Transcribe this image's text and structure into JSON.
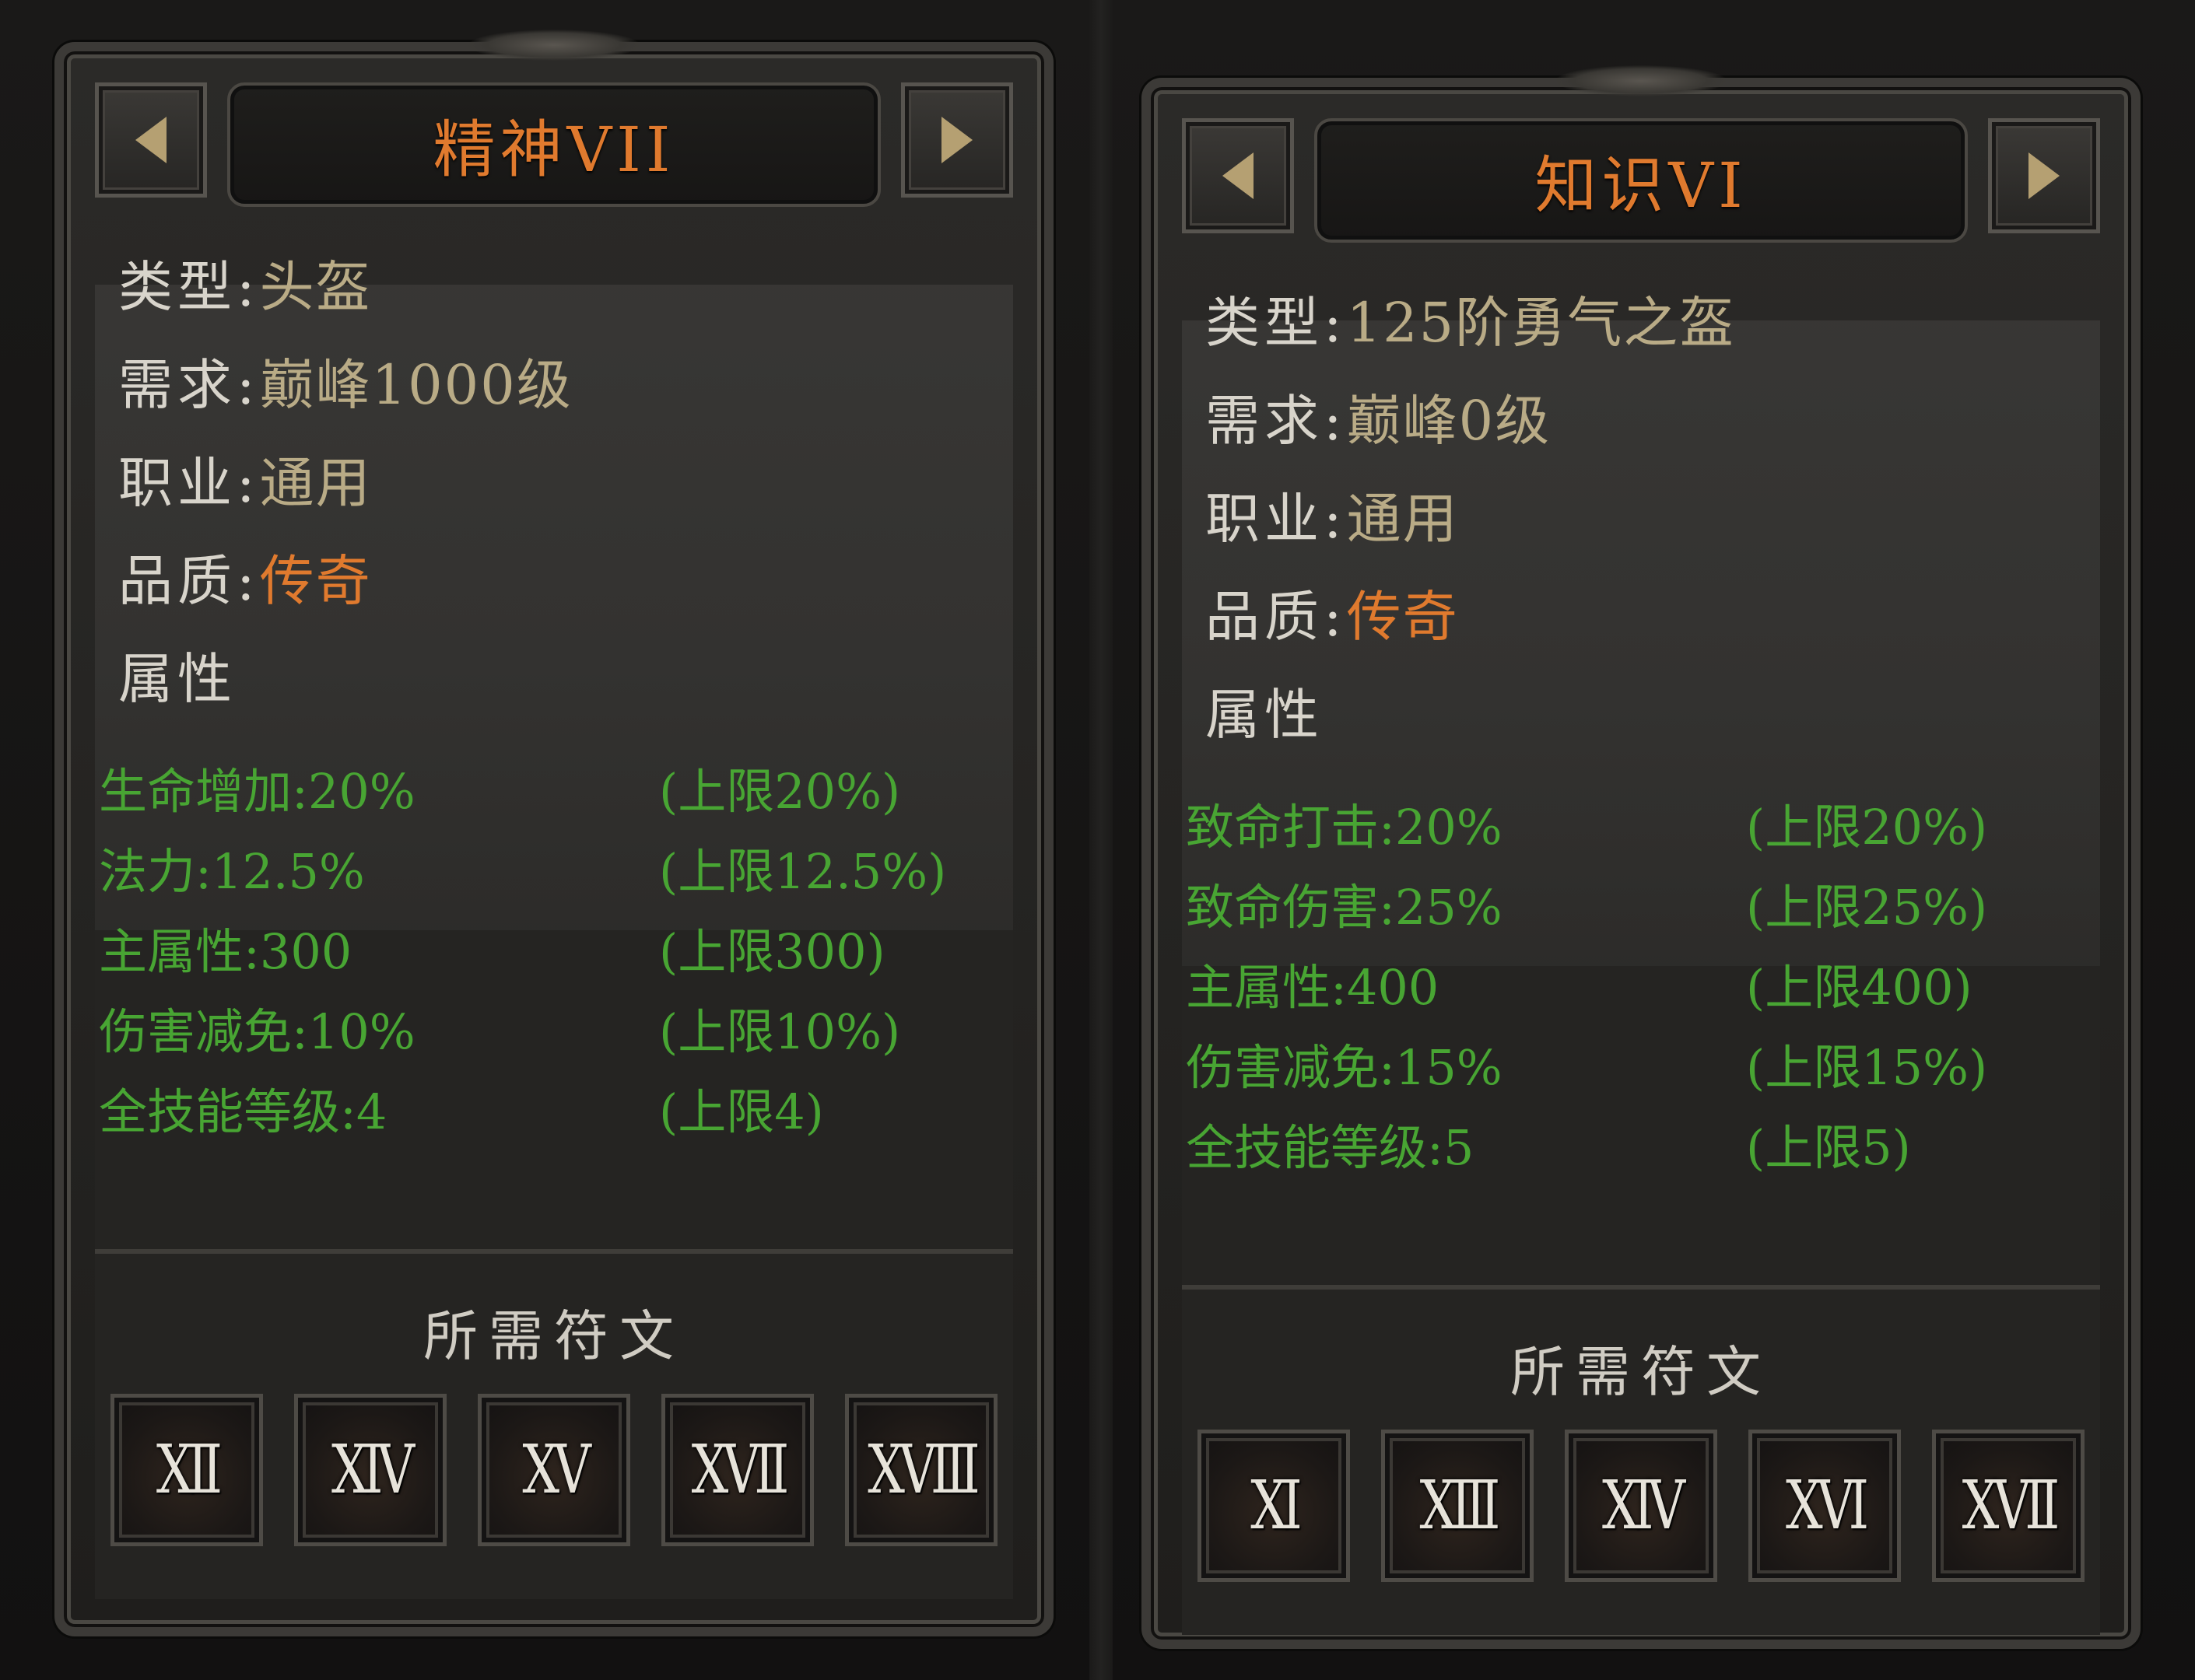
{
  "panels": [
    {
      "title": "精神VII",
      "info": [
        {
          "label": "类型:",
          "value": "头盔"
        },
        {
          "label": "需求:",
          "value": "巅峰1000级"
        },
        {
          "label": "职业:",
          "value": "通用"
        },
        {
          "label": "品质:",
          "value": "传奇"
        }
      ],
      "attr_heading": "属性",
      "attributes": [
        {
          "stat": "生命增加:20%",
          "cap": "(上限20%)"
        },
        {
          "stat": "法力:12.5%",
          "cap": "(上限12.5%)"
        },
        {
          "stat": "主属性:300",
          "cap": "(上限300)"
        },
        {
          "stat": "伤害减免:10%",
          "cap": "(上限10%)"
        },
        {
          "stat": "全技能等级:4",
          "cap": "(上限4)"
        }
      ],
      "runes_title": "所需符文",
      "runes": [
        "XII",
        "XIV",
        "XV",
        "XVII",
        "XVIII"
      ]
    },
    {
      "title": "知识VI",
      "info": [
        {
          "label": "类型:",
          "value": "125阶勇气之盔"
        },
        {
          "label": "需求:",
          "value": "巅峰0级"
        },
        {
          "label": "职业:",
          "value": "通用"
        },
        {
          "label": "品质:",
          "value": "传奇"
        }
      ],
      "attr_heading": "属性",
      "attributes": [
        {
          "stat": "致命打击:20%",
          "cap": "(上限20%)"
        },
        {
          "stat": "致命伤害:25%",
          "cap": "(上限25%)"
        },
        {
          "stat": "主属性:400",
          "cap": "(上限400)"
        },
        {
          "stat": "伤害减免:15%",
          "cap": "(上限15%)"
        },
        {
          "stat": "全技能等级:5",
          "cap": "(上限5)"
        }
      ],
      "runes_title": "所需符文",
      "runes": [
        "XI",
        "XIII",
        "XIV",
        "XVI",
        "XVII"
      ]
    }
  ],
  "colors": {
    "title": "#e07a2e",
    "quality_legendary": "#e07a2e",
    "attribute": "#48a533",
    "label": "#d8d4cb",
    "value": "#b9ab86"
  },
  "icons": {
    "prev": "triangle-left-icon",
    "next": "triangle-right-icon"
  }
}
